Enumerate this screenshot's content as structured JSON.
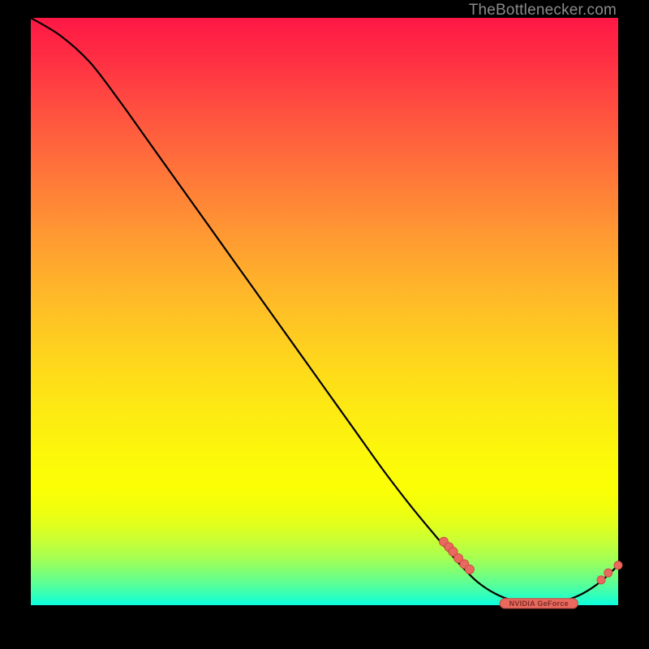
{
  "watermark": "TheBottlenecker.com",
  "colors": {
    "curve": "#000000",
    "dot_fill": "#e9695e",
    "dot_stroke": "#c94e45"
  },
  "chart_data": {
    "type": "line",
    "title": "",
    "xlabel": "",
    "ylabel": "",
    "xlim": [
      0,
      100
    ],
    "ylim": [
      0,
      100
    ],
    "series": [
      {
        "name": "curve",
        "x": [
          0,
          5,
          10,
          15,
          20,
          25,
          30,
          35,
          40,
          45,
          50,
          55,
          60,
          65,
          70,
          73,
          76,
          79,
          82,
          85,
          88,
          91,
          94,
          97,
          100
        ],
        "y": [
          100,
          97,
          92.5,
          86,
          79,
          72,
          65,
          58,
          51,
          44,
          37,
          30,
          23,
          16.5,
          10.5,
          7,
          4,
          2,
          0.8,
          0.3,
          0.3,
          0.8,
          2,
          4,
          6.8
        ]
      }
    ],
    "markers": {
      "cluster_left": [
        {
          "x": 70.3,
          "y": 10.8
        },
        {
          "x": 71.2,
          "y": 9.9
        },
        {
          "x": 71.9,
          "y": 9.1
        },
        {
          "x": 72.8,
          "y": 8.0
        },
        {
          "x": 73.8,
          "y": 7.0
        },
        {
          "x": 74.7,
          "y": 6.1
        }
      ],
      "cluster_right": [
        {
          "x": 97.1,
          "y": 4.3
        },
        {
          "x": 98.3,
          "y": 5.5
        },
        {
          "x": 100.0,
          "y": 6.8
        }
      ],
      "label_pill": {
        "text": "NVIDIA GeForce",
        "x_center": 86.5,
        "y": 0.3
      }
    }
  }
}
